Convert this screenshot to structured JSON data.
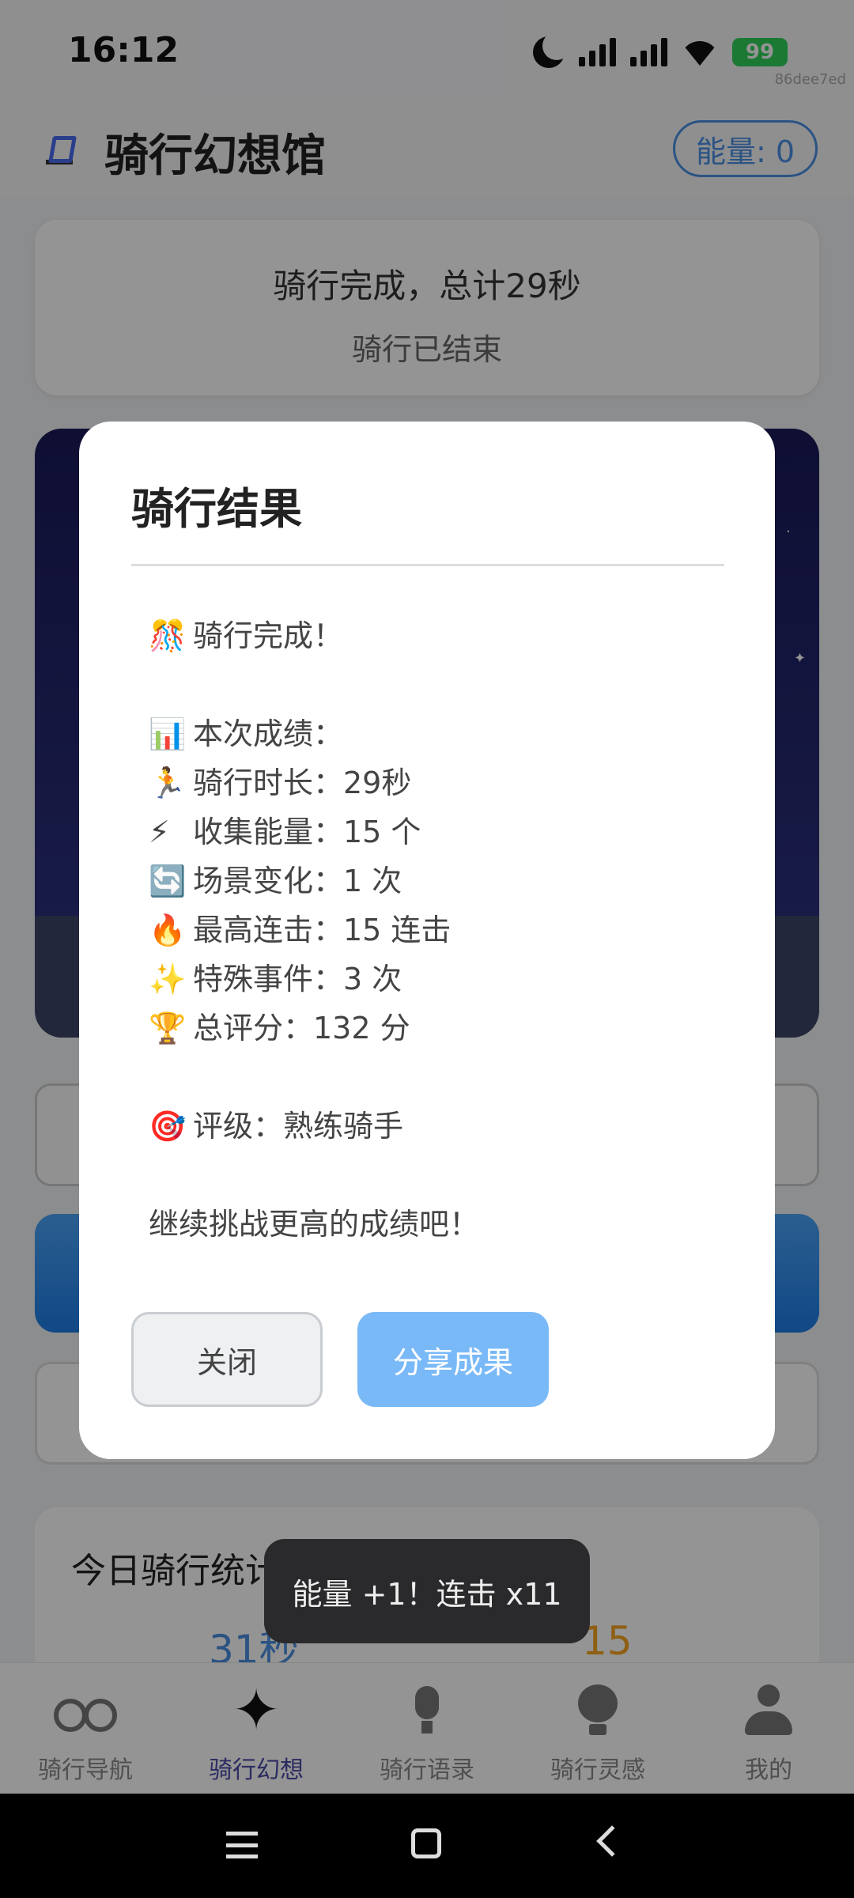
{
  "status_bar": {
    "time": "16:12",
    "battery": "99",
    "hash": "86dee7ed"
  },
  "header": {
    "title": "骑行幻想馆",
    "energy": "能量: 0"
  },
  "summary": {
    "title": "骑行完成，总计29秒",
    "subtitle": "骑行已结束"
  },
  "stats": {
    "title": "今日骑行统计",
    "value_time": "31秒",
    "value_energy": "15"
  },
  "modal": {
    "title": "骑行结果",
    "lines": [
      {
        "emoji": "🎊",
        "text": "骑行完成！"
      },
      {
        "emoji": "📊",
        "text": "本次成绩："
      },
      {
        "emoji": "🏃",
        "text": "骑行时长：29秒"
      },
      {
        "emoji": "⚡",
        "text": "收集能量：15 个"
      },
      {
        "emoji": "🔄",
        "text": "场景变化：1 次"
      },
      {
        "emoji": "🔥",
        "text": "最高连击：15 连击"
      },
      {
        "emoji": "✨",
        "text": "特殊事件：3 次"
      },
      {
        "emoji": "🏆",
        "text": "总评分：132 分"
      },
      {
        "emoji": "🎯",
        "text": "评级：熟练骑手"
      }
    ],
    "footer": "继续挑战更高的成绩吧！",
    "close_label": "关闭",
    "share_label": "分享成果"
  },
  "toast": "能量 +1！连击 x11",
  "nav": [
    {
      "label": "骑行导航",
      "icon": "bike-icon"
    },
    {
      "label": "骑行幻想",
      "icon": "sparkle-icon"
    },
    {
      "label": "骑行语录",
      "icon": "mic-icon"
    },
    {
      "label": "骑行灵感",
      "icon": "lightbulb-icon"
    },
    {
      "label": "我的",
      "icon": "user-icon"
    }
  ],
  "colors": {
    "accent": "#4a90e2",
    "nav_active": "#4b4aa8",
    "share_button": "#7ab9f7"
  }
}
